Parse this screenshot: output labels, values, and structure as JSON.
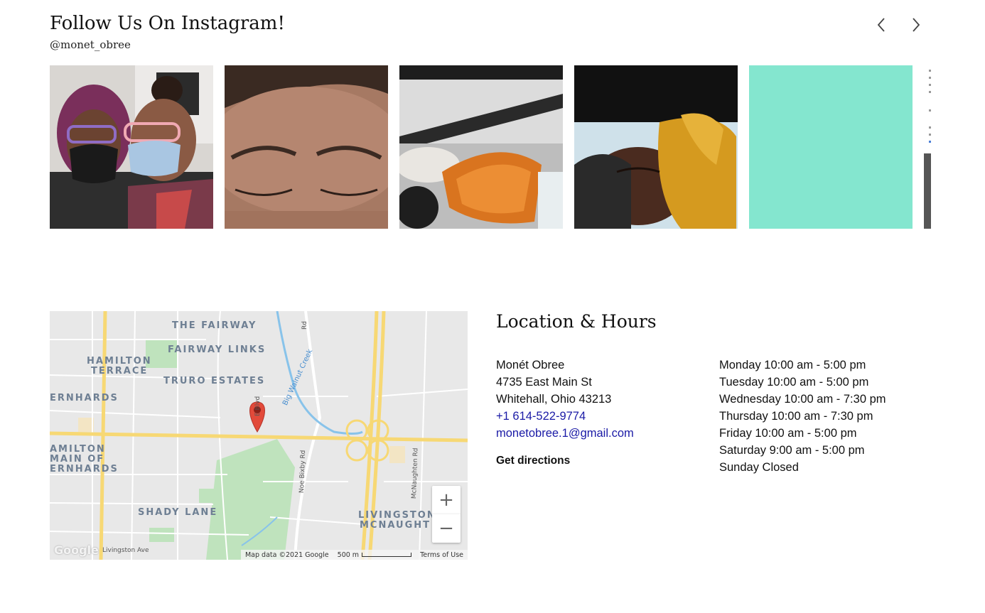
{
  "instagram": {
    "title": "Follow Us On Instagram!",
    "handle": "@monet_obree",
    "colors": {
      "teal_tile": "#84e6cf"
    },
    "tiles": [
      {
        "label": "photo-two-women-masks"
      },
      {
        "label": "photo-closeup-eyebrows"
      },
      {
        "label": "photo-orange-goggles"
      },
      {
        "label": "photo-woman-yellow-headwrap"
      },
      {
        "label": "teal-solid-tile"
      },
      {
        "label": "partial-next-tile"
      }
    ]
  },
  "map": {
    "labels": {
      "the_fairway": "THE FAIRWAY",
      "fairway_links": "FAIRWAY LINKS",
      "hamilton_terrace_1": "HAMILTON",
      "hamilton_terrace_2": "TERRACE",
      "truro_estates": "TRURO ESTATES",
      "bernhards": "ERNHARDS",
      "hamilton_main_1": "AMILTON",
      "hamilton_main_2": "MAIN OF",
      "hamilton_main_3": "ERNHARDS",
      "shady_lane": "SHADY LANE",
      "livingston_1": "LIVINGSTON",
      "livingston_2": "MCNAUGHT",
      "big_walnut_creek": "Big Walnut Creek",
      "noe_bixby": "Noe Bixby Rd",
      "mcnaughten": "McNaughten Rd",
      "livingston_ave": "Livingston Ave",
      "fairway_rd": "Rd",
      "blvd": "E Blvd"
    },
    "zoom_in": "+",
    "zoom_out": "−",
    "google_logo": "Google",
    "attribution": "Map data ©2021 Google",
    "scale_label": "500 m",
    "terms": "Terms of Use"
  },
  "location": {
    "title": "Location & Hours",
    "name": "Monét Obree",
    "street": "4735 East Main St",
    "city": "Whitehall, Ohio 43213",
    "phone": "+1 614-522-9774",
    "email": "monetobree.1@gmail.com",
    "directions": "Get directions",
    "hours": [
      "Monday 10:00 am - 5:00 pm",
      "Tuesday 10:00 am - 5:00 pm",
      "Wednesday 10:00 am - 7:30 pm",
      "Thursday 10:00 am - 7:30 pm",
      "Friday 10:00 am - 5:00 pm",
      "Saturday 9:00 am - 5:00 pm",
      "Sunday Closed"
    ]
  }
}
